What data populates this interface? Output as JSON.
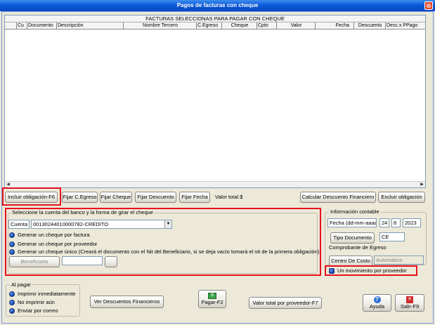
{
  "window": {
    "title": "Pagos de facturas con cheque",
    "close": "⊗"
  },
  "grid": {
    "title": "FACTURAS SELECCIONAS PARA PAGAR CON CHEQUE",
    "columns": [
      "Cu",
      "Documento",
      "Descripción",
      "Nombre Tercero",
      "C.Egreso",
      "Cheque",
      "Cpto",
      "Valor",
      "Fecha",
      "Descuento",
      "Desc.x.PPago"
    ]
  },
  "toolbar": {
    "incluir": "Incluir obligación-F6",
    "fijar_egreso": "Fijar C.Egreso",
    "fijar_cheque": "Fijar Cheque",
    "fijar_descuento": "Fijar Descuento",
    "fijar_fecha": "Fijar Fecha",
    "valor_total_label": "Valor total $",
    "calcular": "Calcular Descuento Financiero",
    "excluir": "Excluir obligación"
  },
  "cuenta_group": {
    "title": "Seleccione la cuenta del banco y la forma de girar el cheque",
    "cuenta_label": "Cuenta",
    "cuenta_value": "00130244010000782-CREDITO",
    "options": [
      "Generar un cheque por factura",
      "Generar un cheque por proveedor",
      "Generar un cheque único (Creará el documento con el Nit del Beneficiario, si se deja vacío tomará el nit de la primera obligación)"
    ],
    "beneficiario": "Beneficiario"
  },
  "contable": {
    "title": "Información contable",
    "fecha_label": "Fecha (dd-mm-aaaa)",
    "day": "24",
    "month": "8",
    "year": "2023",
    "tipo_doc_button": "Tipo Documento",
    "tipo_doc_value": "CE",
    "comprobante": "Comprobante de Egreso",
    "centro_costo_button": "Centro De Costo",
    "centro_costo_value": "Automático",
    "movimiento": "Un movimiento por proveedor"
  },
  "al_pagar": {
    "title": "Al pagar",
    "options": [
      "Imprimir inmediatamente",
      "No imprimir aún",
      "Enviar por correo"
    ]
  },
  "bottom": {
    "ver_descuentos": "Ver Descuentos Financieros",
    "pagar": "Pagar-F2",
    "valor_total_proveedor": "Valor total por proveedor-F7",
    "ayuda": "Ayuda",
    "salir": "Salir-F9"
  }
}
